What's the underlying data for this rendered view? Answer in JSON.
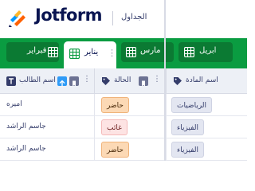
{
  "header": {
    "brand": "Jotform",
    "app_title": "الجداول"
  },
  "tabs": [
    {
      "label": "فبراير",
      "active": false
    },
    {
      "label": "يناير",
      "active": true
    },
    {
      "label": "مارس",
      "active": false
    },
    {
      "label": "ابريل",
      "active": false
    }
  ],
  "table": {
    "columns": [
      {
        "label": "اسم الطالب",
        "icon": "text-type-icon"
      },
      {
        "label": "الحالة",
        "icon": "tag-icon"
      },
      {
        "label": "اسم المادة",
        "icon": "tag-icon"
      }
    ],
    "rows": [
      {
        "student": "اميره",
        "status": "حاضر",
        "subject": "الرياضيات"
      },
      {
        "student": "جاسم الراشد",
        "status": "غائب",
        "subject": "الفيزياء"
      },
      {
        "student": "جاسم الراشد",
        "status": "حاضر",
        "subject": "الفيزياء"
      }
    ]
  },
  "colors": {
    "brand_navy": "#0a1551",
    "tabbar_green": "#0a9c41",
    "present_chip": "#fcd9b5",
    "absent_chip": "#fde3e3",
    "sort_badge": "#2f9bf7"
  }
}
